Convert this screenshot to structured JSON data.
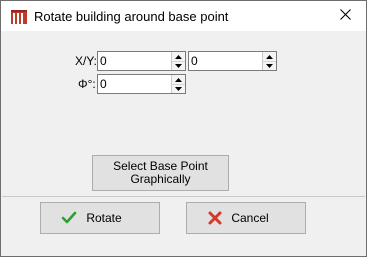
{
  "window": {
    "title": "Rotate building around base point",
    "icon": "building-icon",
    "close_icon": "close-icon"
  },
  "form": {
    "xy_label": "X/Y:",
    "x_value": "0",
    "y_value": "0",
    "phi_label": "Φ°:",
    "phi_value": "0"
  },
  "select_base_point": {
    "line1": "Select Base Point",
    "line2": "Graphically"
  },
  "buttons": {
    "rotate_label": "Rotate",
    "rotate_icon": "checkmark-icon",
    "cancel_label": "Cancel",
    "cancel_icon": "x-icon"
  },
  "colors": {
    "accent_check": "#2e9e2e",
    "cancel_red": "#d43a2a",
    "icon_red": "#c0392b"
  }
}
